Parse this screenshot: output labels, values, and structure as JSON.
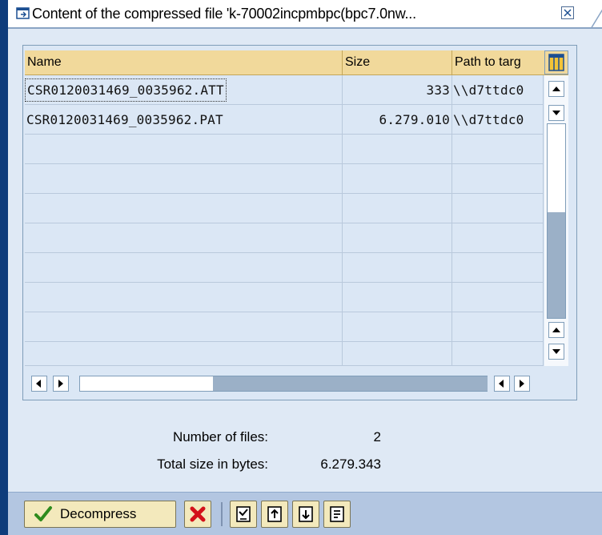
{
  "window": {
    "title": "Content of the compressed file 'k-70002incpmbpc(bpc7.0nw...",
    "close_icon": "close-icon"
  },
  "table": {
    "columns": [
      "Name",
      "Size",
      "Path to targ"
    ],
    "rows": [
      {
        "name": "CSR0120031469_0035962.ATT",
        "size": "333",
        "path": "\\\\d7ttdc0"
      },
      {
        "name": "CSR0120031469_0035962.PAT",
        "size": "6.279.010",
        "path": "\\\\d7ttdc0"
      }
    ],
    "empty_rows": 8,
    "vertical_scroll_fraction": 0.5
  },
  "summary": {
    "files_label": "Number of files:",
    "files_value": "2",
    "size_label": "Total size in bytes:",
    "size_value": "6.279.343"
  },
  "toolbar": {
    "decompress_label": "Decompress",
    "icons": [
      "checkmark-icon",
      "cancel-icon",
      "select-all-icon",
      "deselect-all-icon",
      "select-block-icon",
      "sort-icon"
    ]
  },
  "colors": {
    "header_bg": "#f1d99b",
    "row_bg": "#dbe7f5",
    "footer_bg": "#b3c6e1",
    "accent_dark": "#0e3c7b"
  }
}
